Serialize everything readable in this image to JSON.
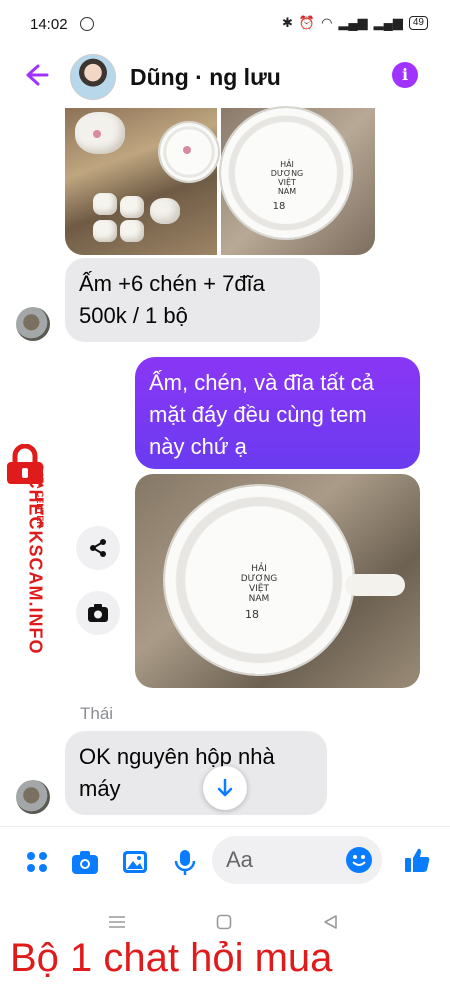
{
  "status": {
    "time": "14:02",
    "battery": "49"
  },
  "header": {
    "title": "Dũng · ng lưu",
    "info_glyph": "i"
  },
  "stamp": {
    "line1": "HẢI",
    "line2": "DƯƠNG",
    "line3": "VIỆT",
    "line4": "NAM",
    "mark": "18"
  },
  "messages": {
    "m1": "Ấm +6 chén + 7đĩa 500k / 1 bộ",
    "m2": "Ấm, chén, và đĩa tất cả mặt đáy đều cùng tem này chứ ạ",
    "sender": "Thái",
    "m3": "OK nguyên hộp nhà máy"
  },
  "composer": {
    "placeholder": "Aa"
  },
  "watermark": {
    "main": "CHECKSCAM.INFO",
    "sub": "DATA CENTER"
  },
  "caption": "Bộ 1 chat hỏi mua",
  "colors": {
    "accent": "#a033ff",
    "bubble_out": "#7a38f2",
    "composer_icon": "#0a7cff",
    "watermark": "#e01b1b"
  }
}
